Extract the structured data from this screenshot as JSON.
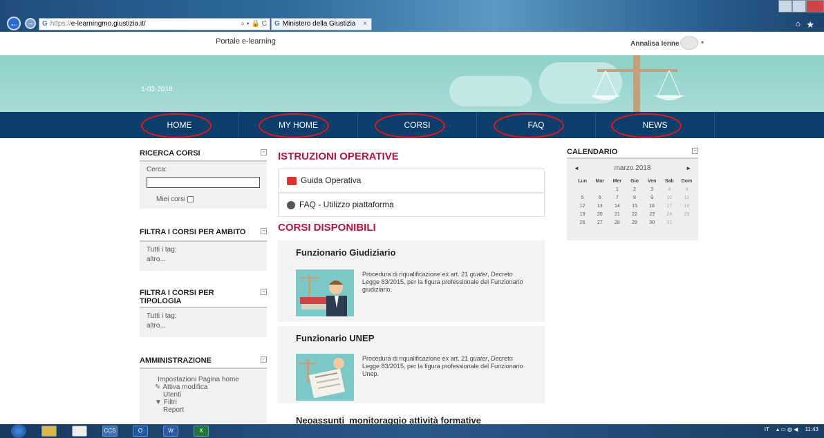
{
  "browser": {
    "url_proto": "https://",
    "url_host": "e-learningmo.giustizia.it/",
    "addr_controls": "⌕ ▾ 🔒 C",
    "tab_title": "Ministero della Giustizia",
    "tab_close": "×",
    "favicon": "G"
  },
  "header": {
    "portal_name": "Portale e-learning",
    "user_name": "Annalisa Ienne",
    "caret": "▾"
  },
  "banner": {
    "date": "1-03-2018"
  },
  "nav": {
    "items": [
      "HOME",
      "MY HOME",
      "CORSI",
      "FAQ",
      "NEWS"
    ]
  },
  "left": {
    "ricerca": {
      "title": "RICERCA CORSI",
      "cerca_label": "Cerca:",
      "miei_corsi": "Miei corsi"
    },
    "filtra_ambito": {
      "title": "FILTRA I CORSI PER AMBITO",
      "tags_label": "Tutti i tag:",
      "tag": "altro..."
    },
    "filtra_tipologia": {
      "title_l1": "FILTRA I CORSI PER",
      "title_l2": "TIPOLOGIA",
      "tags_label": "Tutti i tag:",
      "tag": "altro..."
    },
    "amministrazione": {
      "title": "AMMINISTRAZIONE",
      "items": [
        "Impostazioni Pagina home",
        "Attiva modifica",
        "Utenti",
        "Filtri",
        "Report"
      ]
    }
  },
  "main": {
    "istruzioni_title": "ISTRUZIONI OPERATIVE",
    "resources": [
      "Guida Operativa",
      "FAQ - Utilizzo piattaforma"
    ],
    "corsi_title": "CORSI DISPONIBILI",
    "courses": [
      {
        "title": "Funzionario Giudiziario",
        "desc_pre": "Procedura di riqualificazione ex art. 21 ",
        "desc_em": "quater",
        "desc_post": ", Decreto Legge 83/2015, per la figura professionale del Funzionario giudiziario."
      },
      {
        "title": "Funzionario UNEP",
        "desc_pre": "Procedura di riqualificazione ex art. 21 ",
        "desc_em": "quater",
        "desc_post": ", Decreto Legge 83/2015, per la figura professionale del Funzionario Unep."
      },
      {
        "title": "Neoassunti_monitoraggio attività formative"
      }
    ]
  },
  "calendar": {
    "title": "CALENDARIO",
    "month": "marzo 2018",
    "prev": "◄",
    "next": "►",
    "days": [
      "Lun",
      "Mar",
      "Mer",
      "Gio",
      "Ven",
      "Sab",
      "Dom"
    ],
    "weeks": [
      [
        "",
        "",
        "1",
        "2",
        "3",
        "4"
      ],
      [
        "5",
        "6",
        "7",
        "8",
        "9",
        "10",
        "11"
      ],
      [
        "12",
        "13",
        "14",
        "15",
        "16",
        "17",
        "18"
      ],
      [
        "19",
        "20",
        "21",
        "22",
        "23",
        "24",
        "25"
      ],
      [
        "26",
        "27",
        "28",
        "29",
        "30",
        "31",
        ""
      ]
    ]
  },
  "taskbar": {
    "apps": [
      "",
      "",
      "",
      "CCS",
      "O",
      "W",
      "X"
    ],
    "tray_lang": "IT",
    "clock": "11:43"
  }
}
